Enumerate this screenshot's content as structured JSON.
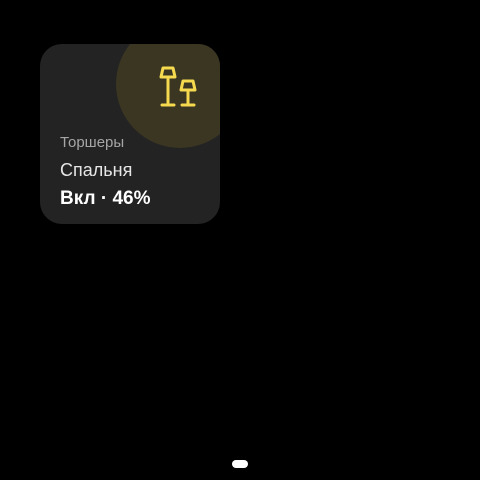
{
  "colors": {
    "background": "#000000",
    "tile_background": "#232323",
    "accent_glow": "#3b3622",
    "icon_yellow": "#f5d94e"
  },
  "tile": {
    "icon": "floor-lamps-icon",
    "category": "Торшеры",
    "room": "Спальня",
    "state": "Вкл",
    "separator": "·",
    "brightness": "46%",
    "brightness_value": 0.46
  },
  "nav": {
    "home_indicator": "home-indicator"
  }
}
